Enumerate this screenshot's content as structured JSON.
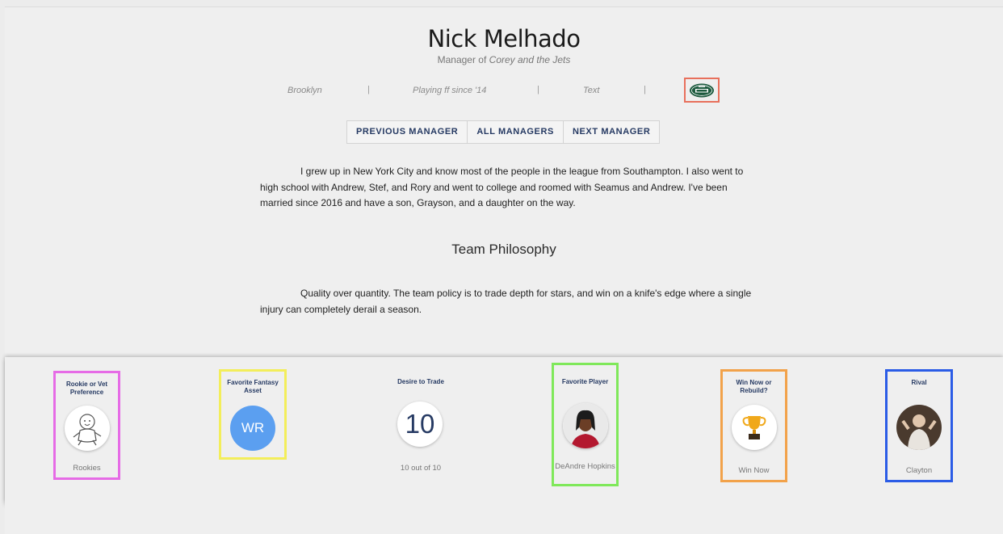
{
  "profile": {
    "name": "Nick Melhado",
    "subtitle_prefix": "Manager of ",
    "team_name": "Corey and the Jets",
    "location": "Brooklyn",
    "playing_since": "Playing ff since '14",
    "extra": "Text",
    "separator": "|",
    "team_logo_icon": "new-york-jets-logo"
  },
  "nav": {
    "previous": "PREVIOUS MANAGER",
    "all": "ALL MANAGERS",
    "next": "NEXT MANAGER"
  },
  "bio": "I grew up in New York City and know most of the people in the league from Southampton. I also went to high school with Andrew, Stef, and Rory and went to college and roomed with Seamus and Andrew. I've been married since 2016 and have a son, Grayson, and a daughter on the way.",
  "philosophy": {
    "title": "Team Philosophy",
    "text": "Quality over quantity. The team policy is to trade depth for stars, and win on a knife's edge where a single injury can completely derail a season."
  },
  "stats": [
    {
      "title": "Rookie or Vet Preference",
      "value": "Rookies",
      "icon": "baby-icon",
      "border": "#e66be6"
    },
    {
      "title": "Favorite Fantasy Asset",
      "value": "",
      "badge": "WR",
      "icon": "wr-badge-icon",
      "border": "#f3ee5a",
      "badge_color": "#5b9ff0"
    },
    {
      "title": "Desire to Trade",
      "value": "10 out of 10",
      "big_number": "10",
      "icon": "",
      "border": ""
    },
    {
      "title": "Favorite Player",
      "value": "DeAndre Hopkins",
      "icon": "player-photo-icon",
      "border": "#7fe85a"
    },
    {
      "title": "Win Now or Rebuild?",
      "value": "Win Now",
      "icon": "trophy-icon",
      "border": "#f2a24a"
    },
    {
      "title": "Rival",
      "value": "Clayton",
      "icon": "rival-photo-icon",
      "border": "#2b5ce6"
    }
  ],
  "colors": {
    "accent": "#263a63",
    "logo_green": "#1e5b3f"
  }
}
